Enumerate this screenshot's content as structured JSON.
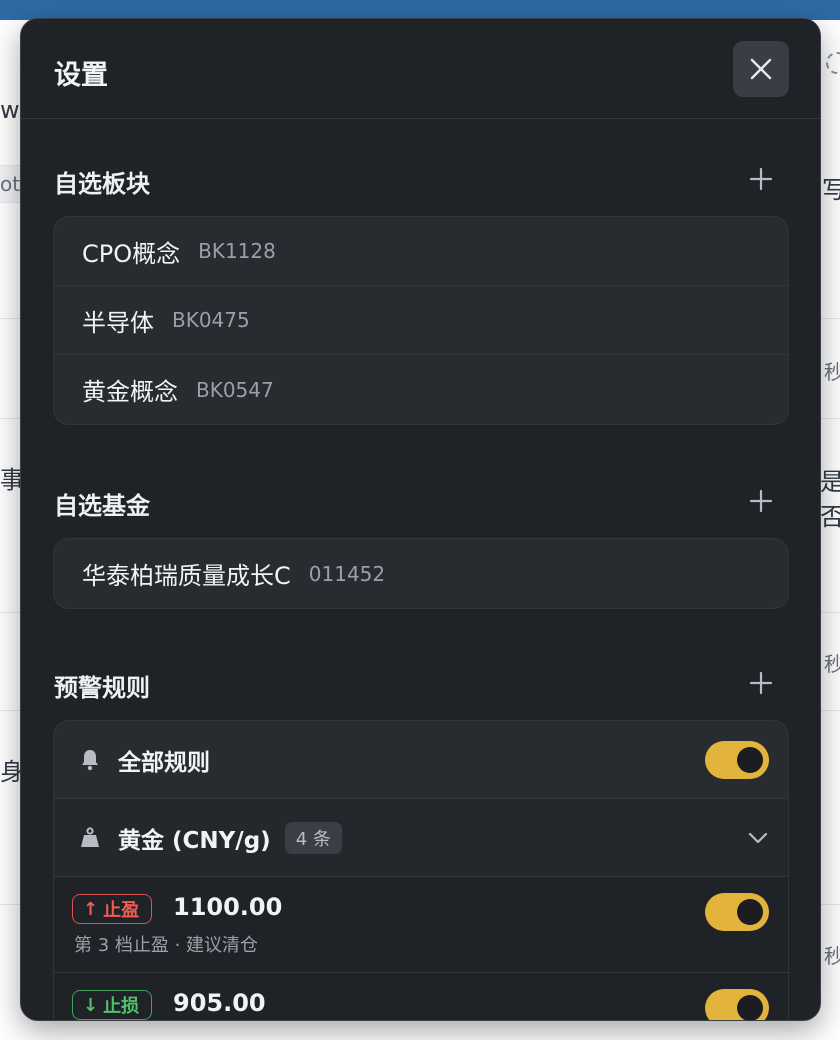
{
  "background": {
    "fragments": [
      "w",
      "ot",
      "事",
      "身",
      "写",
      "秒",
      "是否",
      "秒",
      "秒"
    ]
  },
  "modal": {
    "title": "设置",
    "close_icon": "close-icon"
  },
  "sections": {
    "boards": {
      "title": "自选板块",
      "items": [
        {
          "name": "CPO概念",
          "code": "BK1128"
        },
        {
          "name": "半导体",
          "code": "BK0475"
        },
        {
          "name": "黄金概念",
          "code": "BK0547"
        }
      ]
    },
    "funds": {
      "title": "自选基金",
      "items": [
        {
          "name": "华泰柏瑞质量成长C",
          "code": "011452"
        }
      ]
    },
    "alerts": {
      "title": "预警规则",
      "all_rules": {
        "label": "全部规则",
        "enabled": true,
        "icon": "bell-icon"
      },
      "group": {
        "label": "黄金 (CNY/g)",
        "count": "4 条",
        "icon": "weight-icon",
        "expanded": true
      },
      "rules": [
        {
          "type": "止盈",
          "direction": "↑",
          "price": "1100.00",
          "desc": "第 3 档止盈 · 建议清仓",
          "enabled": true
        },
        {
          "type": "止损",
          "direction": "↓",
          "price": "905.00",
          "desc": "",
          "enabled": true
        }
      ]
    }
  },
  "colors": {
    "accent": "#e3b43c",
    "take_profit": "#f25c54",
    "stop_loss": "#4fc26c",
    "panel": "#1f2226",
    "card": "#282b30"
  }
}
